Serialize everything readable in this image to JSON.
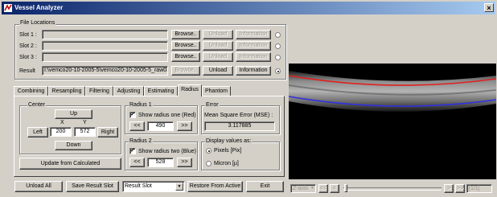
{
  "window": {
    "title": "Vessel Analyzer",
    "close_glyph": "×",
    "icon": "vessel-app-icon"
  },
  "file_locations": {
    "group_label": "File Locations",
    "slots": [
      {
        "label": "Slot 1 :",
        "value": "",
        "browse": "Browse..",
        "unload": "Unload",
        "information": "Information",
        "selected": false
      },
      {
        "label": "Slot 2 :",
        "value": "",
        "browse": "Browse..",
        "unload": "Unload",
        "information": "Information",
        "selected": false
      },
      {
        "label": "Slot 3 :",
        "value": "",
        "browse": "Browse..",
        "unload": "Unload",
        "information": "Information",
        "selected": false
      },
      {
        "label": "Result",
        "value": "I:\\vemco20-10-2005-5\\vemco20-10-2005-5_raw03.",
        "browse": "Browse..",
        "unload": "Unload",
        "information": "Information",
        "selected": true
      }
    ]
  },
  "tabs": [
    "Combining",
    "Resampling",
    "Filtering",
    "Adjusting",
    "Estimating",
    "Radius",
    "Phantom"
  ],
  "active_tab": "Radius",
  "center": {
    "group_label": "Center",
    "up": "Up",
    "down": "Down",
    "left": "Left",
    "right": "Right",
    "x_label": "X",
    "y_label": "Y",
    "x_value": "200",
    "y_value": "572",
    "update_button": "Update from Calculated"
  },
  "radius1": {
    "group_label": "Radius 1",
    "checkbox_label": "Show radius one (Red)",
    "checked": true,
    "dec": "<<",
    "inc": ">>",
    "value": "490"
  },
  "radius2": {
    "group_label": "Radius 2",
    "checkbox_label": "Show radius two (Blue)",
    "checked": true,
    "dec": "<<",
    "inc": ">>",
    "value": "528"
  },
  "error": {
    "group_label": "Error",
    "mse_label": "Mean Square Error (MSE) :",
    "mse_value": "3.117885"
  },
  "display": {
    "group_label": "Display values as:",
    "options": [
      "Pixels [Pix]",
      "Micron [µ]"
    ],
    "selected": "Pixels [Pix]"
  },
  "bottom": {
    "unload_all": "Unload All",
    "save_result_slot": "Save Result Slot",
    "slot_select": "Result Slot",
    "restore": "Restore From Active",
    "exit": "Exit"
  },
  "viewer": {
    "zoom_select": "Z-axis",
    "nav_first": "<<",
    "nav_prev": "<",
    "nav_next": ">",
    "nav_last": ">>",
    "frame_counter": "[1/1]",
    "slider_position": 0.02,
    "colors": {
      "radius_one": "#e02020",
      "radius_two": "#3030e0",
      "tissue": "#b8b8b8"
    }
  }
}
